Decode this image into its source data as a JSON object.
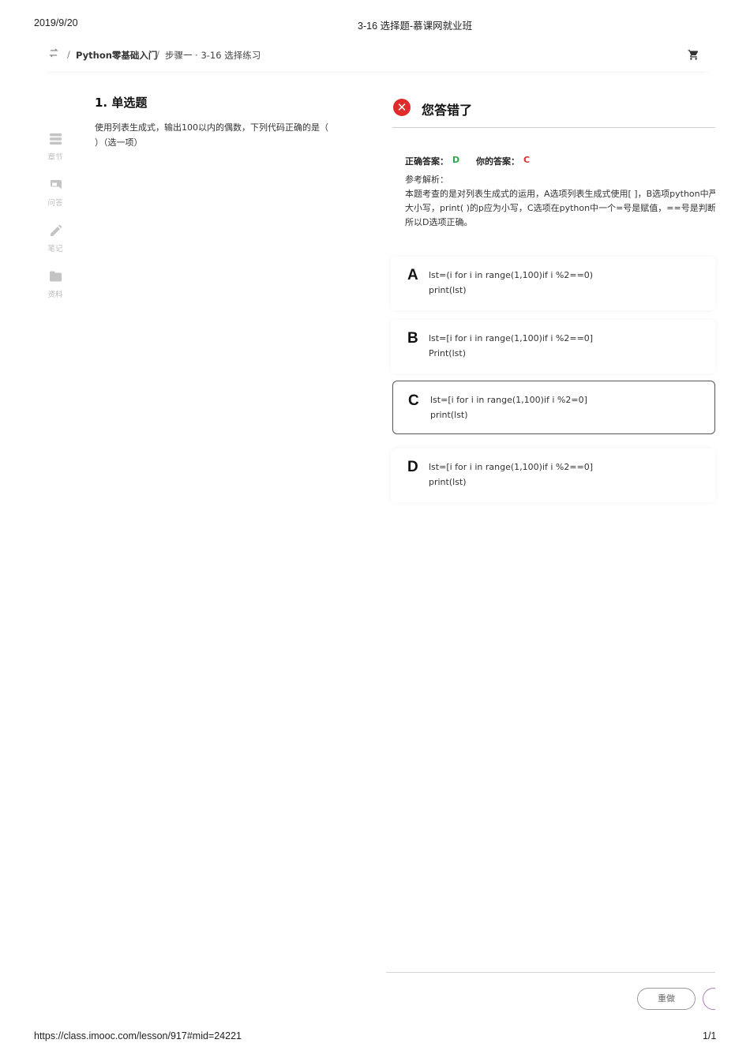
{
  "print_header": {
    "date": "2019/9/20",
    "title": "3-16 选择题-慕课网就业班"
  },
  "breadcrumb": {
    "separator": "/",
    "course": "Python零基础入门",
    "step": "步骤一 · 3-16 选择练习"
  },
  "sidebar": {
    "items": [
      {
        "label": "章节",
        "icon": "chapters-icon"
      },
      {
        "label": "问答",
        "icon": "qa-icon"
      },
      {
        "label": "笔记",
        "icon": "pencil-icon"
      },
      {
        "label": "资料",
        "icon": "folder-icon"
      }
    ]
  },
  "question": {
    "title": "1. 单选题",
    "text": "使用列表生成式，输出100以内的偶数，下列代码正确的是（ ）（选一项）"
  },
  "result": {
    "title": "您答错了",
    "correct_label": "正确答案：",
    "correct_value": "D",
    "yours_label": "你的答案：",
    "yours_value": "C",
    "explanation_label": "参考解析：",
    "explanation_lines": [
      "本题考查的是对列表生成式的运用，A选项列表生成式使用[ ]，B选项python中严格区分",
      "大小写，print( )的p应为小写，C选项在python中一个=号是赋值，==号是判断是否相等，",
      "所以D选项正确。"
    ]
  },
  "options": [
    {
      "letter": "A",
      "code": "lst=(i for i in range(1,100)if i %2==0)\nprint(lst)"
    },
    {
      "letter": "B",
      "code": "lst=[i for i in range(1,100)if i %2==0]\nPrint(lst)"
    },
    {
      "letter": "C",
      "code": "lst=[i for i in range(1,100)if i %2=0]\nprint(lst)"
    },
    {
      "letter": "D",
      "code": "lst=[i for i in range(1,100)if i %2==0]\nprint(lst)"
    }
  ],
  "selected_option": "C",
  "buttons": {
    "redo": "重做"
  },
  "colors": {
    "correct": "#2aa84a",
    "wrong": "#e02b2b"
  },
  "print_footer": {
    "url": "https://class.imooc.com/lesson/917#mid=24221",
    "page": "1/1"
  }
}
